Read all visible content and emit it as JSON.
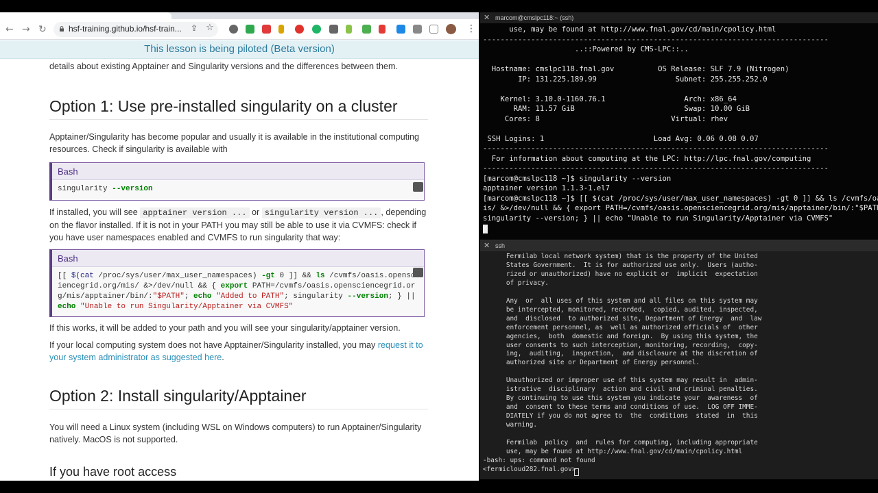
{
  "browser": {
    "url": "hsf-training.github.io/hsf-train...",
    "banner": "This lesson is being piloted (Beta version)"
  },
  "page": {
    "intro_tail": "details about existing Apptainer and Singularity versions and the differences between them.",
    "option1_heading": "Option 1: Use pre-installed singularity on a cluster",
    "option1_para": "Apptainer/Singularity has become popular and usually it is available in the institutional computing resources. Check if singularity is available with",
    "code1_label": "Bash",
    "code1": "singularity --version",
    "installed_pre": "If installed, you will see ",
    "installed_code1": "apptainer version ...",
    "installed_or": " or ",
    "installed_code2": "singularity version ...",
    "installed_post": ", depending on the flavor installed. If it is not in your PATH you may still be able to use it via CVMFS: check if you have user namespaces enabled and CVMFS to run singularity that way:",
    "code2_label": "Bash",
    "code2": "[[ $(cat /proc/sys/user/max_user_namespaces) -gt 0 ]] && ls /cvmfs/oasis.opensciencegrid.org/mis/ &>/dev/null && { export PATH=/cvmfs/oasis.opensciencegrid.org/mis/apptainer/bin/:\"$PATH\"; echo \"Added to PATH\"; singularity --version; } || echo \"Unable to run Singularity/Apptainer via CVMFS\"",
    "works_para": "If this works, it will be added to your path and you will see your singularity/apptainer version.",
    "local_pre": "If your local computing system does not have Apptainer/Singularity installed, you may ",
    "local_link": "request it to your system administrator as suggested here",
    "local_post": ".",
    "option2_heading": "Option 2: Install singularity/Apptainer",
    "option2_para": "You will need a Linux system (including WSL on Windows computers) to run Apptainer/Singularity natively. MacOS is not supported.",
    "root_heading": "If you have root access"
  },
  "term1": {
    "title": "marcom@cmslpc118:~ (ssh)",
    "lines": [
      "      use, may be found at http://www.fnal.gov/cd/main/cpolicy.html",
      "-------------------------------------------------------------------------------",
      "                     ..::Powered by CMS-LPC::..",
      "",
      "  Hostname: cmslpc118.fnal.gov          OS Release: SLF 7.9 (Nitrogen)",
      "        IP: 131.225.189.99                  Subnet: 255.255.252.0",
      "",
      "    Kernel: 3.10.0-1160.76.1                  Arch: x86_64",
      "       RAM: 11.57 GiB                         Swap: 10.00 GiB",
      "     Cores: 8                              Virtual: rhev",
      "",
      " SSH Logins: 1                         Load Avg: 0.06 0.08 0.07",
      "-------------------------------------------------------------------------------",
      "  For information about computing at the LPC: http://lpc.fnal.gov/computing",
      "-------------------------------------------------------------------------------",
      "[marcom@cmslpc118 ~]$ singularity --version",
      "apptainer version 1.1.3-1.el7",
      "[marcom@cmslpc118 ~]$ [[ $(cat /proc/sys/user/max_user_namespaces) -gt 0 ]] && ls /cvmfs/oasis",
      "is/ &>/dev/null && { export PATH=/cvmfs/oasis.opensciencegrid.org/mis/apptainer/bin/:\"$PATH\"; e",
      "singularity --version; } || echo \"Unable to run Singularity/Apptainer via CVMFS\""
    ]
  },
  "term2": {
    "title": "ssh",
    "lines": [
      "      Fermilab local network system) that is the property of the United",
      "      States Government.  It is for authorized use only.  Users (autho-",
      "      rized or unauthorized) have no explicit or  implicit  expectation",
      "      of privacy.",
      "",
      "      Any  or  all uses of this system and all files on this system may",
      "      be intercepted, monitored, recorded,  copied, audited, inspected,",
      "      and  disclosed  to authorized site, Department of Energy  and  law",
      "      enforcement personnel, as  well as authorized officials of  other",
      "      agencies,  both  domestic and foreign.  By using this system, the",
      "      user consents to such interception, monitoring, recording,  copy-",
      "      ing,  auditing,  inspection,  and disclosure at the discretion of",
      "      authorized site or Department of Energy personnel.",
      "",
      "      Unauthorized or improper use of this system may result in  admin-",
      "      istrative  disciplinary  action and civil and criminal penalties.",
      "      By continuing to use this system you indicate your  awareness  of",
      "      and  consent to these terms and conditions of use.  LOG OFF IMME-",
      "      DIATELY if you do not agree to  the  conditions  stated  in  this",
      "      warning.",
      "",
      "      Fermilab  policy  and  rules for computing, including appropriate",
      "      use, may be found at http://www.fnal.gov/cd/main/cpolicy.html",
      "-bash: ups: command not found",
      "<fermicloud282.fnal.gov> "
    ]
  },
  "icons": [
    "back-icon",
    "forward-icon",
    "reload-icon",
    "lock-icon",
    "share-icon",
    "star-icon",
    "menu-icon",
    "copy-icon",
    "close-icon"
  ]
}
